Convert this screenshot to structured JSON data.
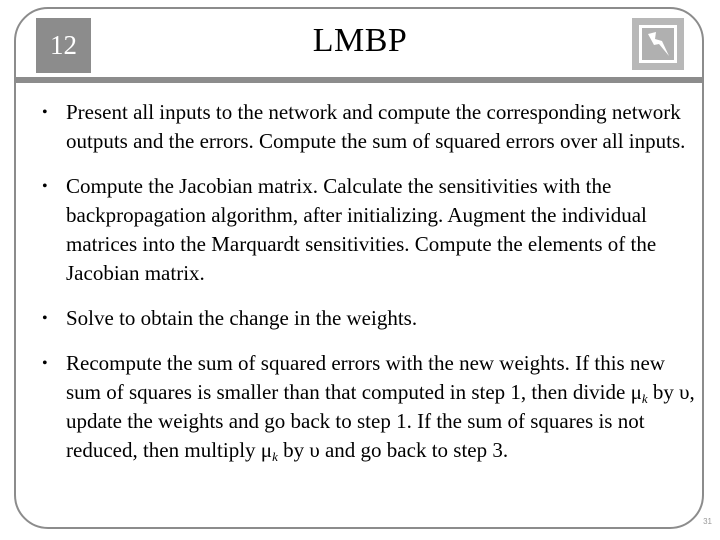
{
  "slide": {
    "number": "12",
    "title": "LMBP",
    "page_number": "31",
    "logo_icon": "lightning-icon"
  },
  "bullets": [
    {
      "text": "Present all inputs to the network and compute the corresponding network outputs and the errors. Compute the sum of squared errors over all inputs."
    },
    {
      "text": "Compute the Jacobian matrix. Calculate the sensitivities with the backpropagation algorithm, after initializing. Augment the individual matrices into the Marquardt sensitivities. Compute the elements of the Jacobian matrix."
    },
    {
      "text": "Solve to obtain the change in the weights."
    },
    {
      "parts": {
        "a": "Recompute the sum of squared errors with the new weights. If this new sum of squares is smaller than that computed in step 1, then divide ",
        "mu": "μ",
        "k": "k",
        "b": " by υ, update the weights and go back to step 1. If the sum of squares is not reduced, then multiply ",
        "mu2": "μ",
        "k2": "k",
        "c": " by υ and go back to step 3."
      }
    }
  ],
  "bullet_glyph": "•"
}
